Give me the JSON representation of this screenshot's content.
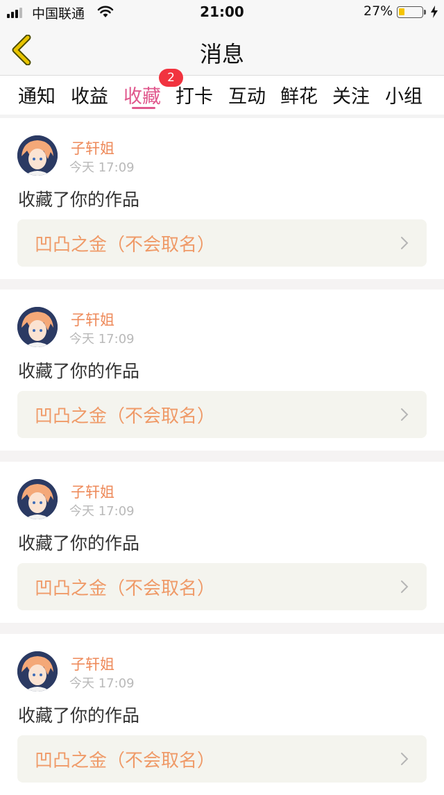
{
  "status_bar": {
    "carrier": "中国联通",
    "time": "21:00",
    "battery_percent": "27%",
    "battery_level": 0.27,
    "icons": [
      "signal-icon",
      "wifi-icon",
      "battery-icon",
      "charging-icon"
    ]
  },
  "header": {
    "title": "消息",
    "back_icon": "chevron-left-icon",
    "back_color": "#e8c400"
  },
  "tabs": {
    "items": [
      "通知",
      "收益",
      "收藏",
      "打卡",
      "互动",
      "鲜花",
      "关注",
      "小组"
    ],
    "active_index": 2,
    "active_color": "#e0588d",
    "badge": "2"
  },
  "feed": {
    "items": [
      {
        "username": "子轩姐",
        "time": "今天 17:09",
        "action": "收藏了你的作品",
        "work_title": "凹凸之金（不会取名）"
      },
      {
        "username": "子轩姐",
        "time": "今天 17:09",
        "action": "收藏了你的作品",
        "work_title": "凹凸之金（不会取名）"
      },
      {
        "username": "子轩姐",
        "time": "今天 17:09",
        "action": "收藏了你的作品",
        "work_title": "凹凸之金（不会取名）"
      },
      {
        "username": "子轩姐",
        "time": "今天 17:09",
        "action": "收藏了你的作品",
        "work_title": "凹凸之金（不会取名）"
      }
    ]
  },
  "colors": {
    "username": "#ee8a5a",
    "work_title": "#ef9a68",
    "badge": "#f1333f"
  }
}
